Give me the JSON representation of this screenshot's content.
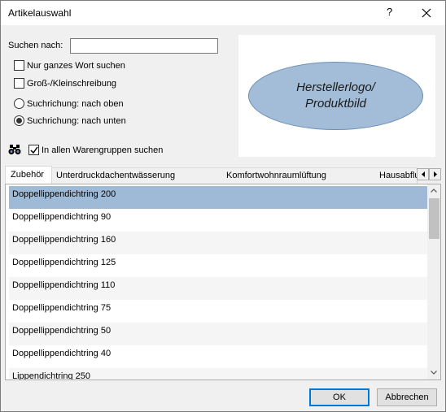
{
  "window": {
    "title": "Artikelauswahl",
    "help_label": "?",
    "close_icon": "close-icon"
  },
  "search": {
    "label": "Suchen nach:",
    "value": "",
    "placeholder": ""
  },
  "options": {
    "whole_word": {
      "label": "Nur ganzes Wort suchen",
      "checked": false
    },
    "case_sensitive": {
      "label": "Groß-/Kleinschreibung",
      "checked": false
    },
    "dir_up": {
      "label": "Suchrichung: nach oben",
      "selected": false
    },
    "dir_down": {
      "label": "Suchrichung: nach unten",
      "selected": true
    },
    "all_groups": {
      "label": "In allen Warengruppen suchen",
      "checked": true
    }
  },
  "logo_panel": {
    "text": "Herstellerlogo/\nProduktbild",
    "fill_color": "#a3bdd8"
  },
  "binoculars_icon": "binoculars-icon",
  "tabs": [
    {
      "label": "Zubehör",
      "active": true
    },
    {
      "label": "Unterdruckdachentwässerung",
      "active": false
    },
    {
      "label": "Komfortwohnraumlüftung",
      "active": false
    },
    {
      "label": "Hausabflu",
      "active": false
    }
  ],
  "list": {
    "items": [
      {
        "label": "Doppellippendichtring 200",
        "selected": true
      },
      {
        "label": "Doppellippendichtring 90",
        "selected": false
      },
      {
        "label": "Doppellippendichtring 160",
        "selected": false
      },
      {
        "label": "Doppellippendichtring 125",
        "selected": false
      },
      {
        "label": "Doppellippendichtring 110",
        "selected": false
      },
      {
        "label": "Doppellippendichtring 75",
        "selected": false
      },
      {
        "label": "Doppellippendichtring 50",
        "selected": false
      },
      {
        "label": "Doppellippendichtring 40",
        "selected": false
      },
      {
        "label": "Lippendichtring 250",
        "selected": false
      }
    ],
    "selection_color": "#9fbad6"
  },
  "buttons": {
    "ok": "OK",
    "cancel": "Abbrechen"
  },
  "accent_color": "#0078d7"
}
